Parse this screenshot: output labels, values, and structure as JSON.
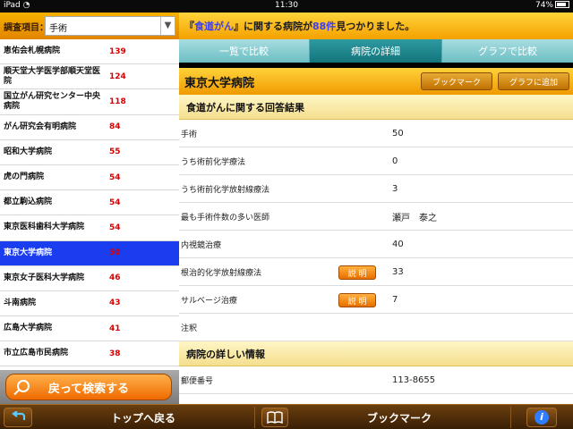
{
  "status": {
    "carrier": "iPad",
    "time": "11:30",
    "battery": "74%"
  },
  "search": {
    "label": "調査項目：",
    "value": "手術"
  },
  "list": [
    {
      "name": "恵佑会札幌病院",
      "count": "139"
    },
    {
      "name": "順天堂大学医学部順天堂医院",
      "count": "124"
    },
    {
      "name": "国立がん研究センター中央病院",
      "count": "118"
    },
    {
      "name": "がん研究会有明病院",
      "count": "84"
    },
    {
      "name": "昭和大学病院",
      "count": "55"
    },
    {
      "name": "虎の門病院",
      "count": "54"
    },
    {
      "name": "都立駒込病院",
      "count": "54"
    },
    {
      "name": "東京医科歯科大学病院",
      "count": "54"
    },
    {
      "name": "東京大学病院",
      "count": "50"
    },
    {
      "name": "東京女子医科大学病院",
      "count": "46"
    },
    {
      "name": "斗南病院",
      "count": "43"
    },
    {
      "name": "広島大学病院",
      "count": "41"
    },
    {
      "name": "市立広島市民病院",
      "count": "38"
    }
  ],
  "back_button": {
    "label": "戻って検索する"
  },
  "banner": {
    "pre": "『",
    "keyword": "食道がん",
    "mid": "』に関する病院が ",
    "count": "88件",
    "post": " 見つかりました。"
  },
  "tabs": [
    {
      "label": "一覧で比較"
    },
    {
      "label": "病院の詳細"
    },
    {
      "label": "グラフで比較"
    }
  ],
  "hospital": {
    "name": "東京大学病院",
    "bookmark_label": "ブックマーク",
    "graph_label": "グラフに追加"
  },
  "section1": {
    "title": "食道がんに関する回答結果"
  },
  "details": [
    {
      "key": "手術",
      "value": "50"
    },
    {
      "key": "うち術前化学療法",
      "value": "0"
    },
    {
      "key": "うち術前化学放射線療法",
      "value": "3"
    },
    {
      "key": "最も手術件数の多い医師",
      "value": "瀬戸　泰之"
    },
    {
      "key": "内視鏡治療",
      "value": "40"
    },
    {
      "key": "根治的化学放射線療法",
      "value": "33",
      "button": "説 明"
    },
    {
      "key": "サルベージ治療",
      "value": "7",
      "button": "説 明"
    },
    {
      "key": "注釈",
      "value": ""
    }
  ],
  "section2": {
    "title": "病院の詳しい情報"
  },
  "details2": [
    {
      "key": "郵便番号",
      "value": "113-8655"
    }
  ],
  "toolbar": {
    "top_label": "トップへ戻る",
    "bookmark_label": "ブックマーク",
    "info_icon": "info-icon"
  }
}
